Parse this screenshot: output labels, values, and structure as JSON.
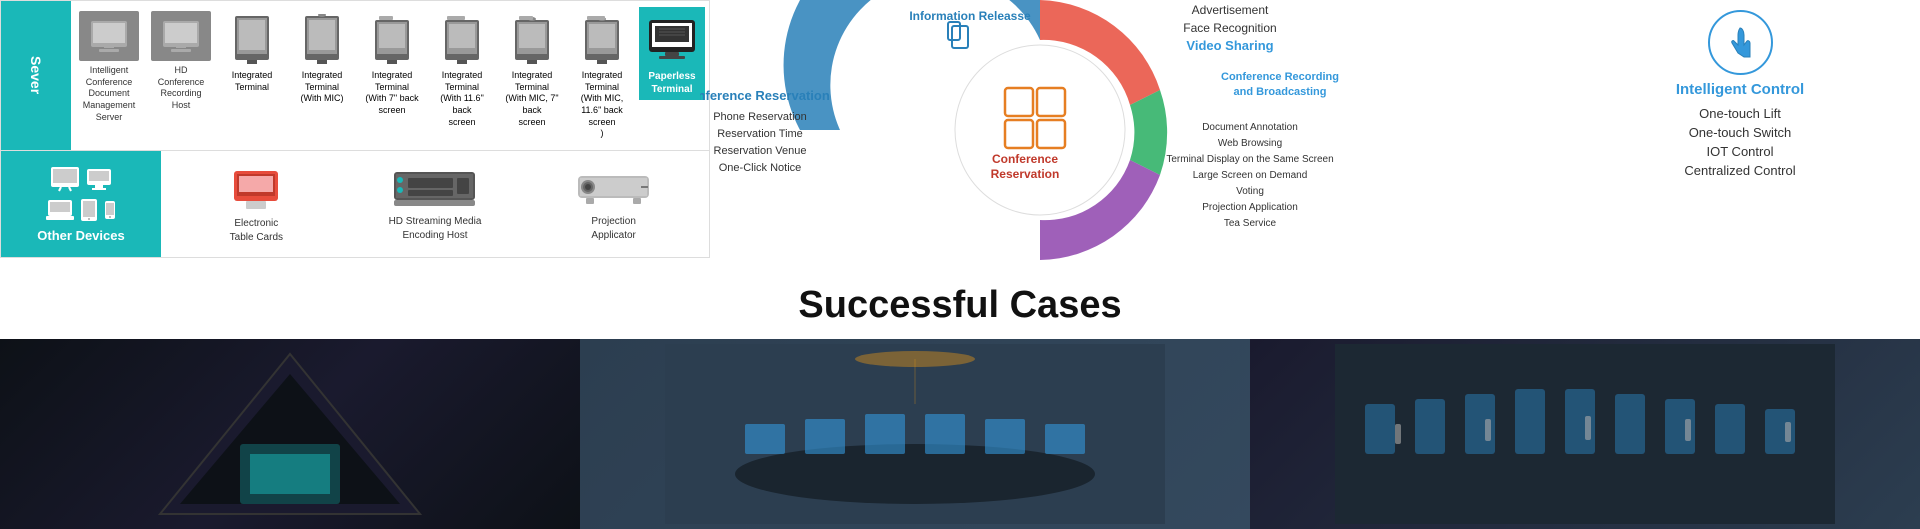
{
  "colors": {
    "teal": "#1ab8b8",
    "red": "#e74c3c",
    "blue": "#2980b9",
    "orange": "#e67e22",
    "green": "#27ae60",
    "purple": "#8e44ad",
    "lightBlue": "#3498db",
    "darkText": "#222",
    "grayBg": "#f5f5f5"
  },
  "server": {
    "label": "Sever"
  },
  "top_devices": [
    {
      "label": "Intelligent Conference\nDocument Management\nServer",
      "type": "server"
    },
    {
      "label": "HD Conference Recording\nHost",
      "type": "server"
    },
    {
      "label": "Integrated\nTerminal",
      "type": "monitor"
    },
    {
      "label": "Integrated\nTerminal\n(With MIC)",
      "type": "monitor"
    },
    {
      "label": "Integrated\nTerminal\n(With 7\" back\nscreen",
      "type": "monitor"
    },
    {
      "label": "Integrated Terminal\n(With 11.6\" back\nscreen",
      "type": "monitor"
    },
    {
      "label": "Integrated Terminal\n(With MIC, 7\" back\nscreen",
      "type": "monitor"
    },
    {
      "label": "Integrated Terminal\n(With MIC, 11.6\" back\nscreen\n)",
      "type": "monitor"
    },
    {
      "label": "Paperless\nTerminal",
      "type": "paperless"
    }
  ],
  "other_devices": {
    "label": "Other Devices"
  },
  "bottom_devices": [
    {
      "label": "Electronic\nTable Cards",
      "type": "table-card"
    },
    {
      "label": "HD Streaming Media\nEncoding Host",
      "type": "streaming"
    },
    {
      "label": "Projection\nApplicator",
      "type": "projection"
    }
  ],
  "diagram": {
    "conference_reservation": {
      "title": "Conference Reservation",
      "items": [
        "Phone Reservation",
        "Reservation Time",
        "Reservation Venue",
        "One-Click Notice"
      ]
    },
    "information_release": {
      "title": "Information Releasse"
    },
    "conference_reservation_center": {
      "title": "Conference\nReservation",
      "items": [
        "Document Annotation",
        "Web Browsing",
        "Terminal Display on the Same Screen",
        "Large Screen on Demand",
        "Voting",
        "Projection Application",
        "Tea Service"
      ]
    },
    "advertisement": {
      "title": "Advertisement"
    },
    "face_recognition": {
      "title": "Face Recognition"
    },
    "video_sharing": {
      "title": "Video Sharing"
    },
    "conference_recording": {
      "title": "Conference Recording\nand Broadcasting",
      "subtitle": "Conference Recording and Broadcasting"
    },
    "intelligent_control": {
      "title": "Intelligent Control",
      "items": [
        "One-touch Lift",
        "One-touch Switch",
        "IOT Control",
        "Centralized Control"
      ]
    }
  },
  "successful_cases": {
    "title": "Successful Cases"
  }
}
